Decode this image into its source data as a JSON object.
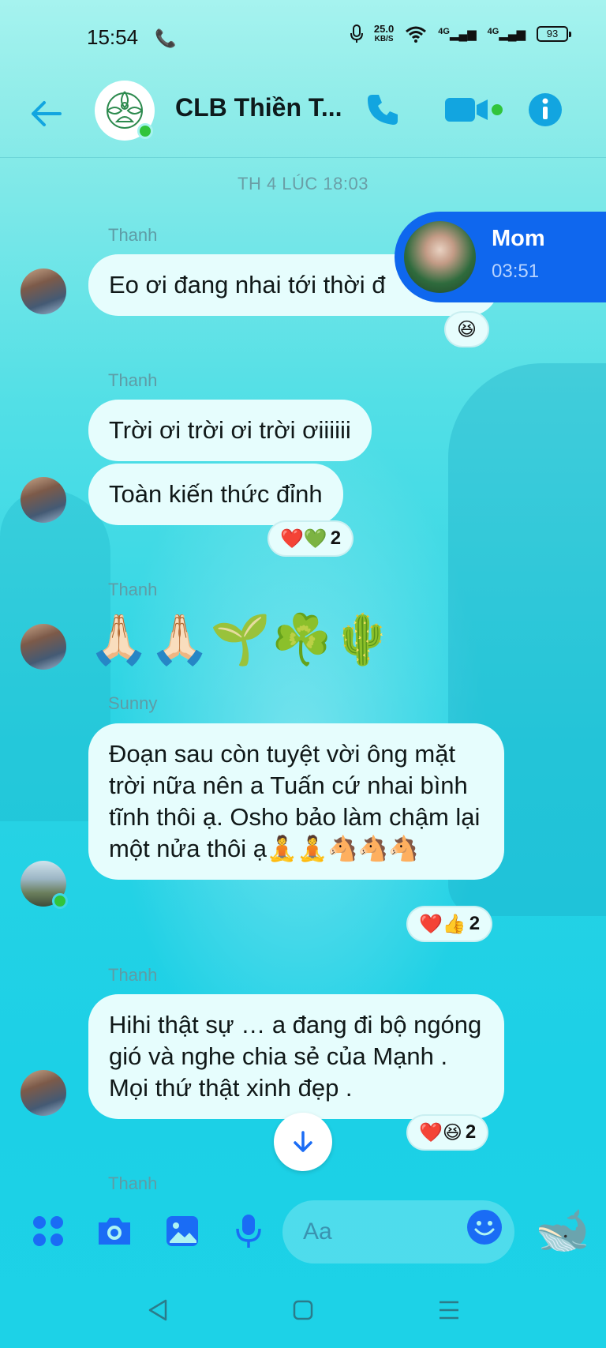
{
  "status_bar": {
    "time": "15:54",
    "speed_value": "25.0",
    "speed_unit": "KB/S",
    "sim1": "4G",
    "sim2": "4G",
    "battery": "93"
  },
  "header": {
    "title": "CLB Thiền T...",
    "icons": [
      "back-arrow-icon",
      "phone-icon",
      "video-camera-icon",
      "info-icon"
    ]
  },
  "date_separator": "TH 4 LÚC 18:03",
  "chat_head": {
    "name": "Mom",
    "time": "03:51"
  },
  "messages": [
    {
      "sender": "Thanh",
      "text": "Eo ơi đang nhai tới thời đ",
      "reaction": {
        "emojis": "😆",
        "count": ""
      }
    },
    {
      "sender": "Thanh",
      "text": "Trời ơi trời ơi trời ơiiiiii"
    },
    {
      "sender": "",
      "text": "Toàn kiến thức đỉnh",
      "reaction": {
        "emojis": "❤️💚",
        "count": "2"
      }
    },
    {
      "sender": "Thanh",
      "text": "🙏🏻🙏🏻🌱☘️🌵"
    },
    {
      "sender": "Sunny",
      "text": "Đoạn sau còn tuyệt vời ông mặt trời nữa nên a Tuấn cứ nhai bình tĩnh thôi ạ. Osho bảo làm chậm lại một nửa thôi ạ🧘🧘🐴🐴🐴",
      "reaction": {
        "emojis": "❤️👍",
        "count": "2"
      }
    },
    {
      "sender": "Thanh",
      "text": "Hihi thật sự … a đang đi bộ ngóng gió và nghe chia sẻ của Mạnh . Mọi thứ thật xinh đẹp .",
      "reaction": {
        "emojis": "❤️😆",
        "count": "2"
      }
    },
    {
      "sender": "Thanh",
      "text": ""
    }
  ],
  "composer": {
    "placeholder": "Aa",
    "icons": [
      "apps-grid-icon",
      "camera-icon",
      "image-icon",
      "microphone-icon",
      "emoji-icon",
      "whale-sticker-icon"
    ]
  },
  "colors": {
    "accent": "#12a5e0",
    "chat_head_bg": "#0f67ee",
    "bubble_bg": "#e6fdfd",
    "online": "#31c43b"
  }
}
